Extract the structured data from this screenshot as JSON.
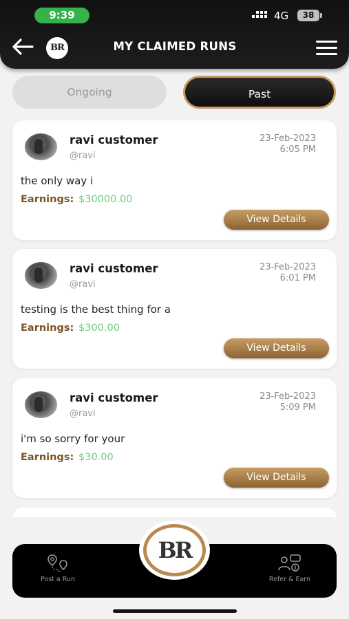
{
  "status_bar": {
    "time": "9:39",
    "network": "4G",
    "battery": "38"
  },
  "header": {
    "title": "MY CLAIMED RUNS",
    "logo_text": "BR"
  },
  "tabs": [
    {
      "label": "Ongoing",
      "active": false
    },
    {
      "label": "Past",
      "active": true
    }
  ],
  "runs": [
    {
      "name": "ravi customer",
      "handle": "@ravi",
      "date": "23-Feb-2023",
      "time": "6:05 PM",
      "text": "the only way i",
      "earnings_label": "Earnings:",
      "earnings": "$30000.00",
      "button": "View Details"
    },
    {
      "name": "ravi customer",
      "handle": "@ravi",
      "date": "23-Feb-2023",
      "time": "6:01 PM",
      "text": "testing is the best thing for a",
      "earnings_label": "Earnings:",
      "earnings": "$300.00",
      "button": "View Details"
    },
    {
      "name": "ravi customer",
      "handle": "@ravi",
      "date": "23-Feb-2023",
      "time": "5:09 PM",
      "text": "i'm so sorry for your",
      "earnings_label": "Earnings:",
      "earnings": "$30.00",
      "button": "View Details"
    }
  ],
  "bottom_nav": {
    "left_label": "Post a Run",
    "right_label": "Refer & Earn",
    "center_logo": "BR"
  },
  "colors": {
    "accent_gold": "#c69c63",
    "earnings_green": "#6fce7a",
    "status_green": "#36b24a"
  }
}
